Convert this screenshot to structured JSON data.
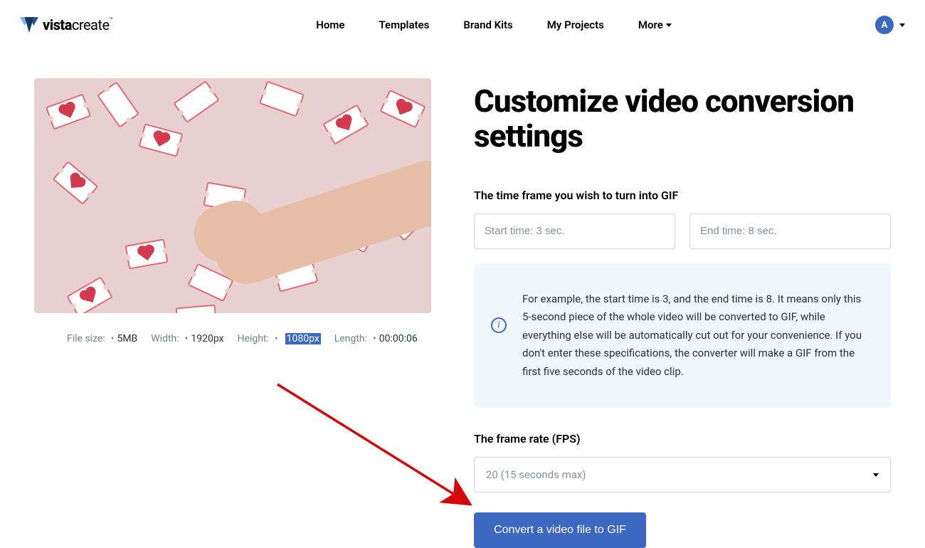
{
  "header": {
    "brand_bold": "vista",
    "brand_light": "create",
    "nav": {
      "home": "Home",
      "templates": "Templates",
      "brand_kits": "Brand Kits",
      "my_projects": "My Projects",
      "more": "More"
    },
    "avatar_initial": "A"
  },
  "left": {
    "meta": {
      "file_size_label": "File size:",
      "file_size_value": "5MB",
      "width_label": "Width:",
      "width_value": "1920px",
      "height_label": "Height:",
      "height_value": "1080px",
      "length_label": "Length:",
      "length_value": "00:00:06"
    }
  },
  "right": {
    "title": "Customize video conversion settings",
    "time_label": "The time frame you wish to turn into GIF",
    "start_placeholder": "Start time: 3 sec.",
    "end_placeholder": "End time: 8 sec.",
    "info_text": "For example, the start time is 3, and the end time is 8. It means only this 5-second piece of the whole video will be converted to GIF, while everything else will be automatically cut out for your convenience. If you don't enter these specifications, the converter will make a GIF from the first five seconds of the video clip.",
    "fps_label": "The frame rate (FPS)",
    "fps_value": "20 (15 seconds max)",
    "button": "Convert a video file to GIF"
  }
}
